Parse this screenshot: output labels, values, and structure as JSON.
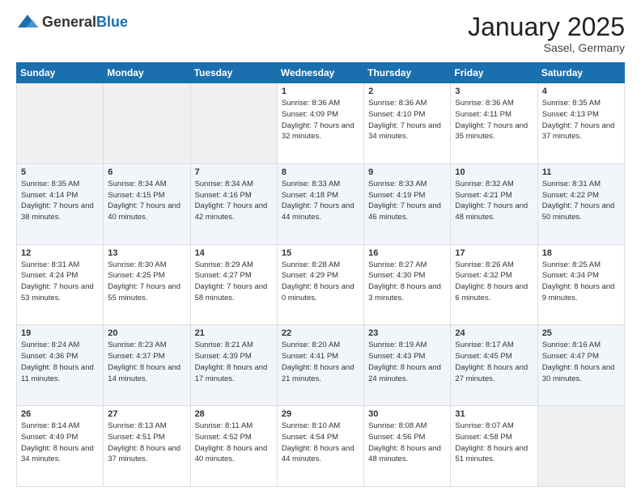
{
  "header": {
    "logo_general": "General",
    "logo_blue": "Blue",
    "month": "January 2025",
    "location": "Sasel, Germany"
  },
  "weekdays": [
    "Sunday",
    "Monday",
    "Tuesday",
    "Wednesday",
    "Thursday",
    "Friday",
    "Saturday"
  ],
  "weeks": [
    [
      {
        "day": "",
        "sunrise": "",
        "sunset": "",
        "daylight": ""
      },
      {
        "day": "",
        "sunrise": "",
        "sunset": "",
        "daylight": ""
      },
      {
        "day": "",
        "sunrise": "",
        "sunset": "",
        "daylight": ""
      },
      {
        "day": "1",
        "sunrise": "Sunrise: 8:36 AM",
        "sunset": "Sunset: 4:09 PM",
        "daylight": "Daylight: 7 hours and 32 minutes."
      },
      {
        "day": "2",
        "sunrise": "Sunrise: 8:36 AM",
        "sunset": "Sunset: 4:10 PM",
        "daylight": "Daylight: 7 hours and 34 minutes."
      },
      {
        "day": "3",
        "sunrise": "Sunrise: 8:36 AM",
        "sunset": "Sunset: 4:11 PM",
        "daylight": "Daylight: 7 hours and 35 minutes."
      },
      {
        "day": "4",
        "sunrise": "Sunrise: 8:35 AM",
        "sunset": "Sunset: 4:13 PM",
        "daylight": "Daylight: 7 hours and 37 minutes."
      }
    ],
    [
      {
        "day": "5",
        "sunrise": "Sunrise: 8:35 AM",
        "sunset": "Sunset: 4:14 PM",
        "daylight": "Daylight: 7 hours and 38 minutes."
      },
      {
        "day": "6",
        "sunrise": "Sunrise: 8:34 AM",
        "sunset": "Sunset: 4:15 PM",
        "daylight": "Daylight: 7 hours and 40 minutes."
      },
      {
        "day": "7",
        "sunrise": "Sunrise: 8:34 AM",
        "sunset": "Sunset: 4:16 PM",
        "daylight": "Daylight: 7 hours and 42 minutes."
      },
      {
        "day": "8",
        "sunrise": "Sunrise: 8:33 AM",
        "sunset": "Sunset: 4:18 PM",
        "daylight": "Daylight: 7 hours and 44 minutes."
      },
      {
        "day": "9",
        "sunrise": "Sunrise: 8:33 AM",
        "sunset": "Sunset: 4:19 PM",
        "daylight": "Daylight: 7 hours and 46 minutes."
      },
      {
        "day": "10",
        "sunrise": "Sunrise: 8:32 AM",
        "sunset": "Sunset: 4:21 PM",
        "daylight": "Daylight: 7 hours and 48 minutes."
      },
      {
        "day": "11",
        "sunrise": "Sunrise: 8:31 AM",
        "sunset": "Sunset: 4:22 PM",
        "daylight": "Daylight: 7 hours and 50 minutes."
      }
    ],
    [
      {
        "day": "12",
        "sunrise": "Sunrise: 8:31 AM",
        "sunset": "Sunset: 4:24 PM",
        "daylight": "Daylight: 7 hours and 53 minutes."
      },
      {
        "day": "13",
        "sunrise": "Sunrise: 8:30 AM",
        "sunset": "Sunset: 4:25 PM",
        "daylight": "Daylight: 7 hours and 55 minutes."
      },
      {
        "day": "14",
        "sunrise": "Sunrise: 8:29 AM",
        "sunset": "Sunset: 4:27 PM",
        "daylight": "Daylight: 7 hours and 58 minutes."
      },
      {
        "day": "15",
        "sunrise": "Sunrise: 8:28 AM",
        "sunset": "Sunset: 4:29 PM",
        "daylight": "Daylight: 8 hours and 0 minutes."
      },
      {
        "day": "16",
        "sunrise": "Sunrise: 8:27 AM",
        "sunset": "Sunset: 4:30 PM",
        "daylight": "Daylight: 8 hours and 3 minutes."
      },
      {
        "day": "17",
        "sunrise": "Sunrise: 8:26 AM",
        "sunset": "Sunset: 4:32 PM",
        "daylight": "Daylight: 8 hours and 6 minutes."
      },
      {
        "day": "18",
        "sunrise": "Sunrise: 8:25 AM",
        "sunset": "Sunset: 4:34 PM",
        "daylight": "Daylight: 8 hours and 9 minutes."
      }
    ],
    [
      {
        "day": "19",
        "sunrise": "Sunrise: 8:24 AM",
        "sunset": "Sunset: 4:36 PM",
        "daylight": "Daylight: 8 hours and 11 minutes."
      },
      {
        "day": "20",
        "sunrise": "Sunrise: 8:23 AM",
        "sunset": "Sunset: 4:37 PM",
        "daylight": "Daylight: 8 hours and 14 minutes."
      },
      {
        "day": "21",
        "sunrise": "Sunrise: 8:21 AM",
        "sunset": "Sunset: 4:39 PM",
        "daylight": "Daylight: 8 hours and 17 minutes."
      },
      {
        "day": "22",
        "sunrise": "Sunrise: 8:20 AM",
        "sunset": "Sunset: 4:41 PM",
        "daylight": "Daylight: 8 hours and 21 minutes."
      },
      {
        "day": "23",
        "sunrise": "Sunrise: 8:19 AM",
        "sunset": "Sunset: 4:43 PM",
        "daylight": "Daylight: 8 hours and 24 minutes."
      },
      {
        "day": "24",
        "sunrise": "Sunrise: 8:17 AM",
        "sunset": "Sunset: 4:45 PM",
        "daylight": "Daylight: 8 hours and 27 minutes."
      },
      {
        "day": "25",
        "sunrise": "Sunrise: 8:16 AM",
        "sunset": "Sunset: 4:47 PM",
        "daylight": "Daylight: 8 hours and 30 minutes."
      }
    ],
    [
      {
        "day": "26",
        "sunrise": "Sunrise: 8:14 AM",
        "sunset": "Sunset: 4:49 PM",
        "daylight": "Daylight: 8 hours and 34 minutes."
      },
      {
        "day": "27",
        "sunrise": "Sunrise: 8:13 AM",
        "sunset": "Sunset: 4:51 PM",
        "daylight": "Daylight: 8 hours and 37 minutes."
      },
      {
        "day": "28",
        "sunrise": "Sunrise: 8:11 AM",
        "sunset": "Sunset: 4:52 PM",
        "daylight": "Daylight: 8 hours and 40 minutes."
      },
      {
        "day": "29",
        "sunrise": "Sunrise: 8:10 AM",
        "sunset": "Sunset: 4:54 PM",
        "daylight": "Daylight: 8 hours and 44 minutes."
      },
      {
        "day": "30",
        "sunrise": "Sunrise: 8:08 AM",
        "sunset": "Sunset: 4:56 PM",
        "daylight": "Daylight: 8 hours and 48 minutes."
      },
      {
        "day": "31",
        "sunrise": "Sunrise: 8:07 AM",
        "sunset": "Sunset: 4:58 PM",
        "daylight": "Daylight: 8 hours and 51 minutes."
      },
      {
        "day": "",
        "sunrise": "",
        "sunset": "",
        "daylight": ""
      }
    ]
  ]
}
